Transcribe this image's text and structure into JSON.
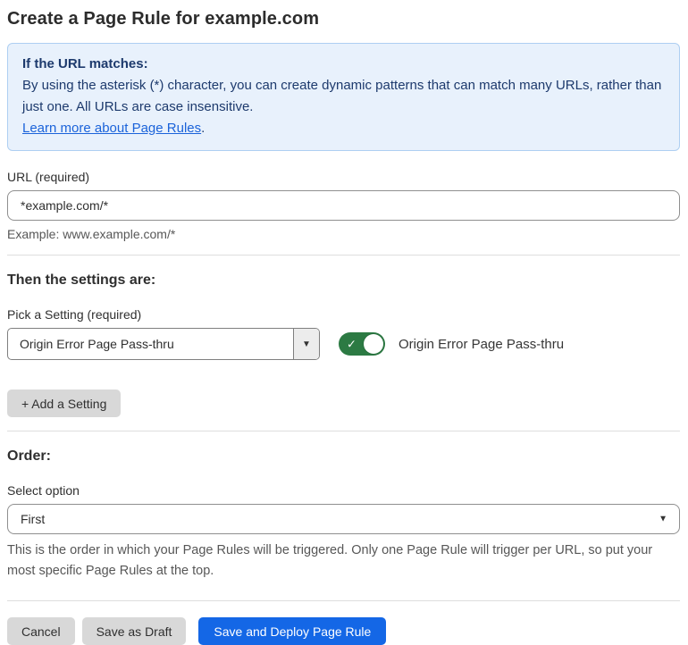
{
  "page": {
    "title": "Create a Page Rule for example.com"
  },
  "info_box": {
    "heading": "If the URL matches:",
    "body": "By using the asterisk (*) character, you can create dynamic patterns that can match many URLs, rather than just one. All URLs are case insensitive.",
    "link_label": "Learn more about Page Rules",
    "link_suffix": "."
  },
  "url_field": {
    "label": "URL (required)",
    "value": "*example.com/*",
    "hint": "Example: www.example.com/*"
  },
  "settings_section": {
    "heading": "Then the settings are:",
    "picker_label": "Pick a Setting (required)",
    "selected_setting": "Origin Error Page Pass-thru",
    "toggle": {
      "state": "on",
      "label": "Origin Error Page Pass-thru"
    },
    "add_setting_label": "+ Add a Setting"
  },
  "order_section": {
    "heading": "Order:",
    "select_label": "Select option",
    "selected_option": "First",
    "hint": "This is the order in which your Page Rules will be triggered. Only one Page Rule will trigger per URL, so put your most specific Page Rules at the top."
  },
  "actions": {
    "cancel_label": "Cancel",
    "save_draft_label": "Save as Draft",
    "save_deploy_label": "Save and Deploy Page Rule"
  },
  "icons": {
    "dropdown_arrow": "▼",
    "toggle_check": "✓"
  },
  "colors": {
    "info_bg": "#e8f1fc",
    "info_border": "#aecff2",
    "info_text": "#1d3a6d",
    "link_blue": "#1b63da",
    "toggle_green": "#2c7a43",
    "primary_blue": "#1467e6",
    "button_gray": "#d8d8d8"
  }
}
